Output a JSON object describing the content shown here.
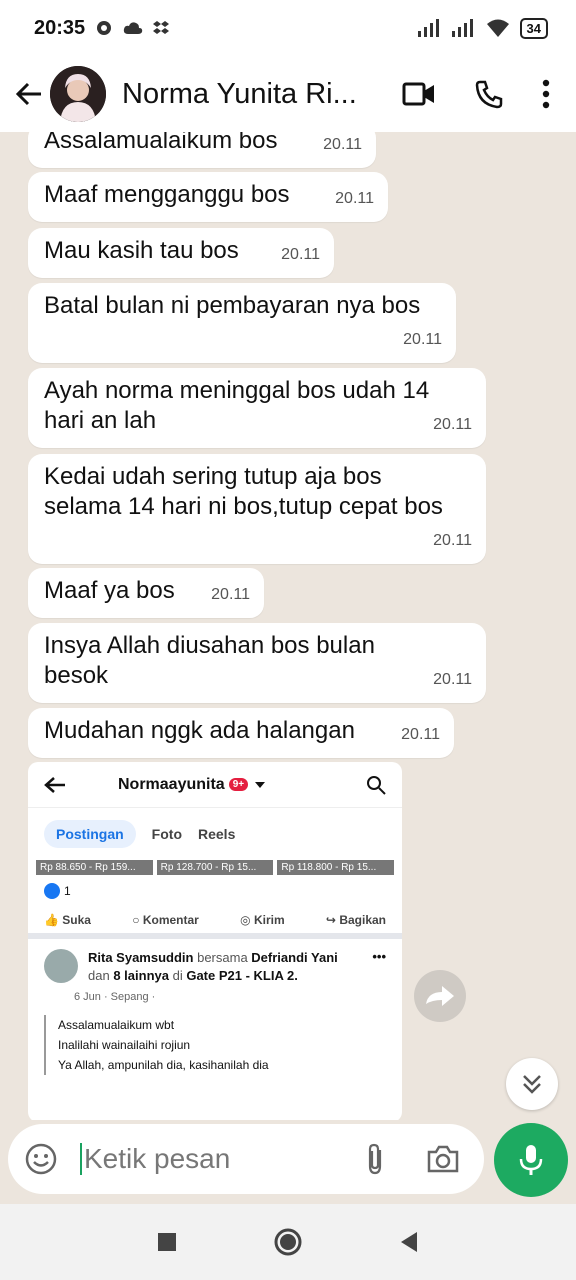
{
  "status": {
    "time": "20:35",
    "battery": "34"
  },
  "header": {
    "contact_name": "Norma Yunita Ri..."
  },
  "messages": [
    {
      "text": "Assalamualaikum bos",
      "time": "20.11"
    },
    {
      "text": "Maaf mengganggu bos",
      "time": "20.11"
    },
    {
      "text": "Mau kasih tau bos",
      "time": "20.11"
    },
    {
      "text": "Batal bulan ni pembayaran nya bos",
      "time": "20.11"
    },
    {
      "text": "Ayah norma meninggal bos udah 14 hari an lah",
      "time": "20.11"
    },
    {
      "text": "Kedai udah sering tutup aja bos selama 14 hari ni bos,tutup cepat bos",
      "time": "20.11"
    },
    {
      "text": "Maaf ya bos",
      "time": "20.11"
    },
    {
      "text": "Insya Allah diusahan bos bulan besok",
      "time": "20.11"
    },
    {
      "text": "Mudahan nggk ada halangan",
      "time": "20.11"
    }
  ],
  "image_message": {
    "profile_name": "Normaayunita",
    "badge": "9+",
    "tabs": [
      "Postingan",
      "Foto",
      "Reels"
    ],
    "prices": [
      "Rp 88.650 - Rp 159...",
      "Rp 128.700 - Rp 15...",
      "Rp 118.800 - Rp 15..."
    ],
    "like_count": "1",
    "actions": [
      "Suka",
      "Komentar",
      "Kirim",
      "Bagikan"
    ],
    "post_author": "Rita Syamsuddin",
    "post_with_word": "bersama",
    "post_tagged": "Defriandi Yani",
    "post_and": "dan",
    "post_others": "8 lainnya",
    "post_at": "di",
    "post_place": "Gate P21 - KLIA 2.",
    "post_meta": "6 Jun · Sepang ·",
    "post_lines": [
      "Assalamualaikum wbt",
      "Inalilahi wainailaihi rojiun",
      "Ya Allah, ampunilah dia, kasihanilah dia"
    ]
  },
  "input": {
    "placeholder": "Ketik pesan"
  },
  "colors": {
    "chat_bg": "#ece5dd",
    "bubble": "#ffffff",
    "mic": "#1daa61",
    "fb_blue": "#1b74e4"
  }
}
